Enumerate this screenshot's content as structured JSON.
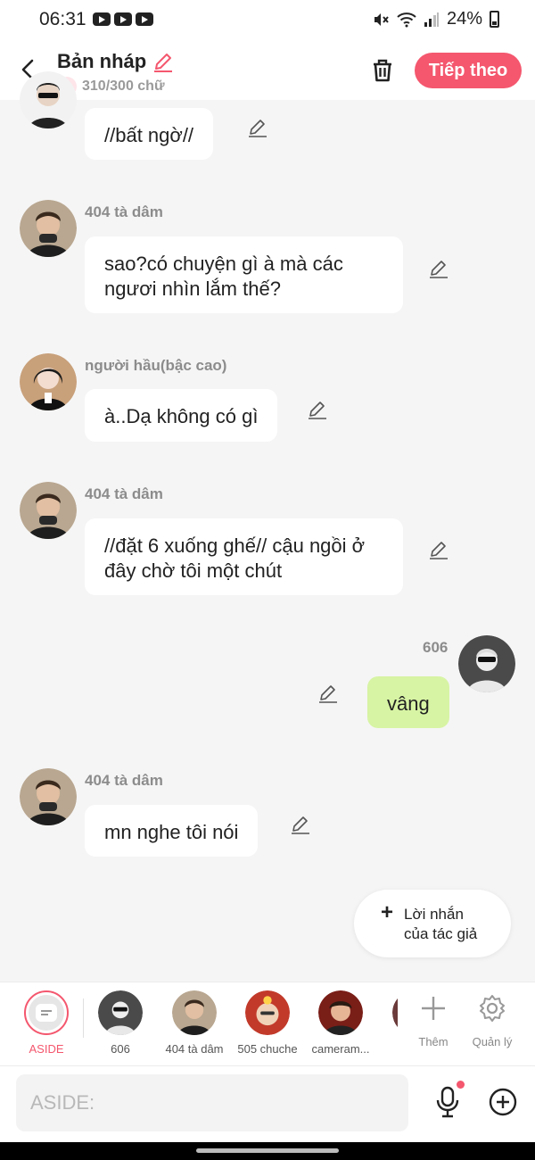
{
  "status": {
    "time": "06:31",
    "battery": "24%"
  },
  "header": {
    "title": "Bản nháp",
    "count": "310/300 chữ",
    "next_label": "Tiếp theo",
    "accent": "#f4576e"
  },
  "messages": [
    {
      "sender": "",
      "text": "//bất ngờ//",
      "side": "left",
      "avatar": "rumor-avatar"
    },
    {
      "sender": "404 tà dâm",
      "text": "sao?có chuyện gì à mà các ngươi nhìn lắm thế?",
      "side": "left",
      "avatar": "404-avatar"
    },
    {
      "sender": "người hầu(bậc cao)",
      "text": "à..Dạ không có gì",
      "side": "left",
      "avatar": "servant-avatar"
    },
    {
      "sender": "404 tà dâm",
      "text": "//đặt 6 xuống ghế// cậu ngồi ở đây chờ tôi một chút",
      "side": "left",
      "avatar": "404-avatar"
    },
    {
      "sender": "606",
      "text": "vâng",
      "side": "right",
      "avatar": "606-avatar",
      "bubble_color": "#d7f4a4"
    },
    {
      "sender": "404 tà dâm",
      "text": "mn nghe tôi nói",
      "side": "left",
      "avatar": "404-avatar"
    }
  ],
  "author_note": {
    "line1": "Lời nhắn",
    "line2": "của tác giả"
  },
  "characters": [
    {
      "label": "ASIDE"
    },
    {
      "label": "606"
    },
    {
      "label": "404 tà dâm"
    },
    {
      "label": "505 chuche"
    },
    {
      "label": "cameram..."
    }
  ],
  "tools": {
    "add_label": "Thêm",
    "manage_label": "Quản lý"
  },
  "input": {
    "placeholder": "ASIDE:"
  }
}
